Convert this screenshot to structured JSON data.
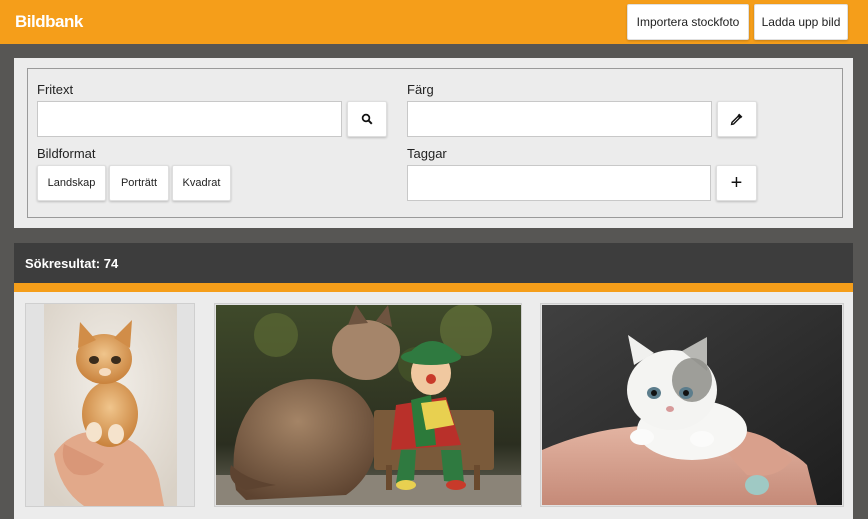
{
  "app": {
    "title": "Bildbank"
  },
  "toolbar": {
    "import_label": "Importera stockfoto",
    "upload_label": "Ladda upp bild"
  },
  "filters": {
    "freetext_label": "Fritext",
    "freetext_value": "",
    "color_label": "Färg",
    "color_value": "",
    "format_label": "Bildformat",
    "formats": [
      "Landskap",
      "Porträtt",
      "Kvadrat"
    ],
    "tags_label": "Taggar",
    "tags_value": "",
    "add_tag_symbol": "+"
  },
  "results": {
    "title": "Sökresultat: 74",
    "images": [
      {
        "subject": "orange kitten held in hand",
        "orientation": "portrait"
      },
      {
        "subject": "cat with clown doll",
        "orientation": "landscape"
      },
      {
        "subject": "white kitten on arm",
        "orientation": "landscape"
      }
    ]
  },
  "icons": {
    "search": "search-icon",
    "color_picker": "eyedropper-icon",
    "add_tag": "plus-icon"
  },
  "colors": {
    "accent": "#f59e1a",
    "dark_bar": "#3d3d3d",
    "background": "#575654",
    "panel": "#ececec"
  }
}
